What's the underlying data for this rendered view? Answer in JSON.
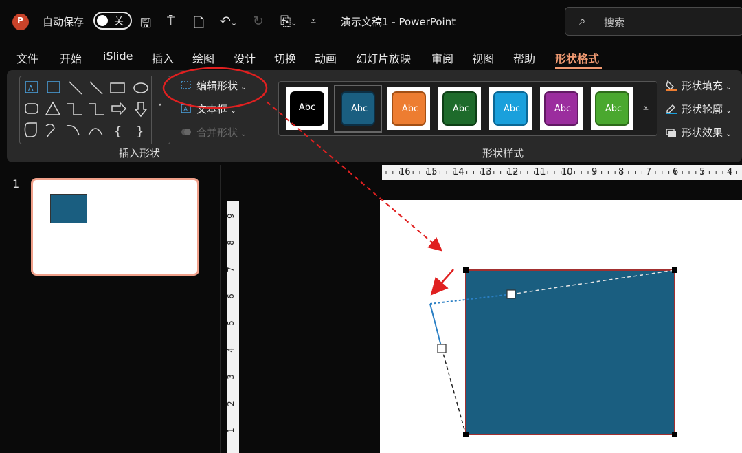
{
  "titlebar": {
    "autosave_label": "自动保存",
    "autosave_state": "关",
    "doc_title": "演示文稿1  -  PowerPoint",
    "search_placeholder": "搜索",
    "icons": [
      "save-icon",
      "present-icon",
      "new-file-icon",
      "undo-icon",
      "redo-icon",
      "touch-mode-icon",
      "customize-icon"
    ]
  },
  "tabs": [
    "文件",
    "开始",
    "iSlide",
    "插入",
    "绘图",
    "设计",
    "切换",
    "动画",
    "幻灯片放映",
    "审阅",
    "视图",
    "帮助",
    "形状格式"
  ],
  "active_tab": "形状格式",
  "ribbon": {
    "insert_shapes": {
      "group_label": "插入形状",
      "edit_shape": "编辑形状",
      "text_box": "文本框",
      "merge_shapes": "合并形状"
    },
    "shape_styles": {
      "group_label": "形状样式",
      "swatch_text": "Abc",
      "swatches": [
        "#000000",
        "#1a5e80",
        "#ed7d31",
        "#1e6b2b",
        "#1aa0dc",
        "#9b2d9e",
        "#4aa82f"
      ],
      "fill": "形状填充",
      "outline": "形状轮廓",
      "effects": "形状效果"
    }
  },
  "slides": {
    "number": "1"
  },
  "h_ruler_labels": [
    "16",
    "15",
    "14",
    "13",
    "12",
    "11",
    "10",
    "9",
    "8",
    "7",
    "6",
    "5",
    "4"
  ],
  "v_ruler_labels": [
    "9",
    "8",
    "7",
    "6",
    "5",
    "4",
    "3",
    "2",
    "1"
  ],
  "colors": {
    "accent": "#f09a72",
    "shape_fill": "#1a5e80",
    "annotation_red": "#e02020"
  }
}
